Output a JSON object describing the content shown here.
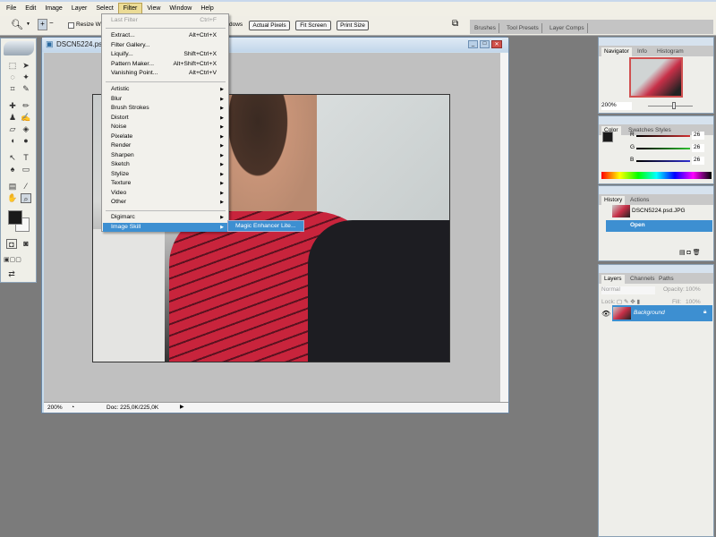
{
  "menubar": {
    "items": [
      "File",
      "Edit",
      "Image",
      "Layer",
      "Select",
      "Filter",
      "View",
      "Window",
      "Help"
    ],
    "active": "Filter"
  },
  "options": {
    "resize_label": "Resize Windows",
    "resize_fragment_left": "Resize Win",
    "resize_fragment_right": "dows",
    "actual_pixels": "Actual Pixels",
    "fit_screen": "Fit Screen",
    "print_size": "Print Size"
  },
  "dock": {
    "tabs": [
      "Brushes",
      "Tool Presets",
      "Layer Comps"
    ]
  },
  "document": {
    "title": "DSCN5224.psd",
    "zoom": "200%",
    "doc_size": "Doc: 225,0K/225,0K"
  },
  "filter_menu": {
    "top": [
      {
        "label": "Last Filter",
        "shortcut": "Ctrl+F",
        "disabled": true
      }
    ],
    "group1": [
      {
        "label": "Extract...",
        "shortcut": "Alt+Ctrl+X"
      },
      {
        "label": "Filter Gallery...",
        "shortcut": ""
      },
      {
        "label": "Liquify...",
        "shortcut": "Shift+Ctrl+X"
      },
      {
        "label": "Pattern Maker...",
        "shortcut": "Alt+Shift+Ctrl+X"
      },
      {
        "label": "Vanishing Point...",
        "shortcut": "Alt+Ctrl+V"
      }
    ],
    "group2": [
      "Artistic",
      "Blur",
      "Brush Strokes",
      "Distort",
      "Noise",
      "Pixelate",
      "Render",
      "Sharpen",
      "Sketch",
      "Stylize",
      "Texture",
      "Video",
      "Other"
    ],
    "group3": [
      "Digimarc",
      "Image Skill"
    ],
    "highlighted": "Image Skill",
    "submenu": [
      "Magic Enhancer Lite..."
    ]
  },
  "navigator": {
    "tabs": [
      "Navigator",
      "Info",
      "Histogram"
    ],
    "zoom": "200%"
  },
  "color": {
    "tabs": [
      "Color",
      "Swatches",
      "Styles"
    ],
    "r_label": "R",
    "g_label": "G",
    "b_label": "B",
    "r": "26",
    "g": "26",
    "b": "26",
    "foreground": "#1a1a1a"
  },
  "history": {
    "tabs": [
      "History",
      "Actions"
    ],
    "snapshot": "DSCN5224.psd.JPG",
    "states": [
      "Open"
    ]
  },
  "layers": {
    "tabs": [
      "Layers",
      "Channels",
      "Paths"
    ],
    "blend_mode": "Normal",
    "opacity_label": "Opacity:",
    "opacity": "100%",
    "lock_label": "Lock:",
    "fill_label": "Fill:",
    "fill": "100%",
    "items": [
      "Background"
    ]
  },
  "colors": {
    "highlight": "#3d8fd1",
    "menu_active": "#ecdc96"
  }
}
